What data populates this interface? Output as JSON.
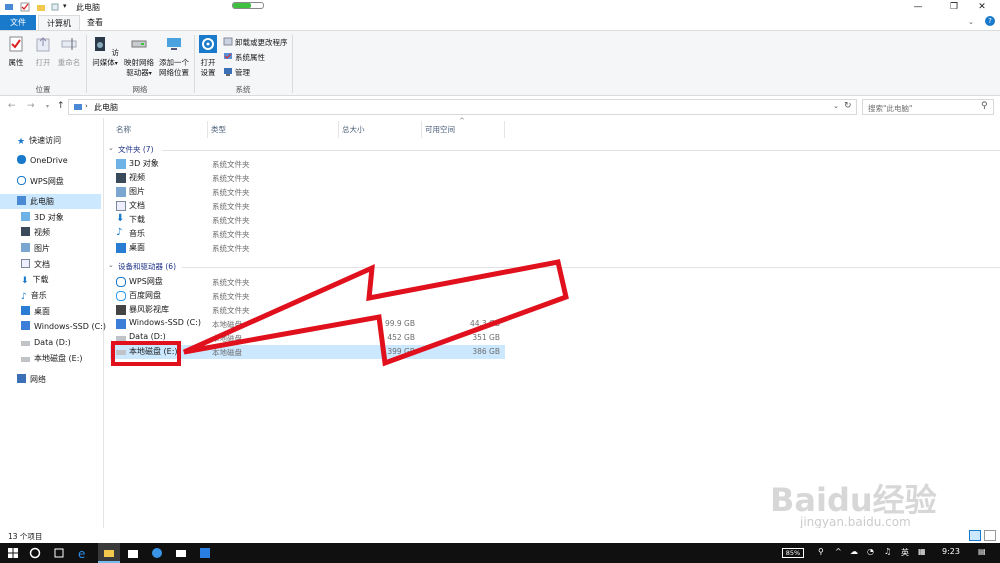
{
  "window": {
    "title": "此电脑",
    "minimize": "—",
    "maximize": "❐",
    "close": "✕"
  },
  "tabs": {
    "file": "文件",
    "computer": "计算机",
    "view": "查看"
  },
  "ribbon": {
    "properties": "属性",
    "open": "打开",
    "rename": "重命名",
    "group_location": "位置",
    "access_media": "访问媒体",
    "map_drive_1": "映射网络",
    "map_drive_2": "驱动器",
    "add_location_1": "添加一个",
    "add_location_2": "网络位置",
    "group_network": "网络",
    "open_settings_1": "打开",
    "open_settings_2": "设置",
    "uninstall": "卸载或更改程序",
    "system_props": "系统属性",
    "manage": "管理",
    "group_system": "系统"
  },
  "address": {
    "path": "此电脑",
    "search_placeholder": "搜索\"此电脑\""
  },
  "columns": {
    "name": "名称",
    "type": "类型",
    "total": "总大小",
    "free": "可用空间"
  },
  "nav": {
    "quick": "快速访问",
    "onedrive": "OneDrive",
    "wps": "WPS网盘",
    "thispc": "此电脑",
    "items": [
      "3D 对象",
      "视频",
      "图片",
      "文档",
      "下载",
      "音乐",
      "桌面",
      "Windows-SSD (C:)",
      "Data (D:)",
      "本地磁盘 (E:)"
    ],
    "network": "网络"
  },
  "groups": {
    "folders": "文件夹 (7)",
    "devices": "设备和驱动器 (6)"
  },
  "folders": [
    {
      "name": "3D 对象",
      "type": "系统文件夹",
      "icon": "3d-objects-icon"
    },
    {
      "name": "视频",
      "type": "系统文件夹",
      "icon": "video-icon"
    },
    {
      "name": "图片",
      "type": "系统文件夹",
      "icon": "pictures-icon"
    },
    {
      "name": "文档",
      "type": "系统文件夹",
      "icon": "documents-icon"
    },
    {
      "name": "下载",
      "type": "系统文件夹",
      "icon": "downloads-icon"
    },
    {
      "name": "音乐",
      "type": "系统文件夹",
      "icon": "music-icon"
    },
    {
      "name": "桌面",
      "type": "系统文件夹",
      "icon": "desktop-icon"
    }
  ],
  "devices": [
    {
      "name": "WPS网盘",
      "type": "系统文件夹",
      "total": "",
      "free": ""
    },
    {
      "name": "百度网盘",
      "type": "系统文件夹",
      "total": "",
      "free": ""
    },
    {
      "name": "暴风影视库",
      "type": "系统文件夹",
      "total": "",
      "free": ""
    },
    {
      "name": "Windows-SSD (C:)",
      "type": "本地磁盘",
      "total": "99.9 GB",
      "free": "44.3 GB"
    },
    {
      "name": "Data (D:)",
      "type": "本地磁盘",
      "total": "452 GB",
      "free": "351 GB"
    },
    {
      "name": "本地磁盘 (E:)",
      "type": "本地磁盘",
      "total": "399 GB",
      "free": "386 GB"
    }
  ],
  "status": {
    "count": "13 个项目"
  },
  "taskbar": {
    "battery": "85%",
    "ime": "英",
    "clock": "9:23"
  },
  "watermark": {
    "brand": "Baidu经验",
    "url": "jingyan.baidu.com"
  },
  "colors": {
    "accent": "#1979ca",
    "selection": "#cce8ff",
    "arrow": "#e0101c"
  }
}
